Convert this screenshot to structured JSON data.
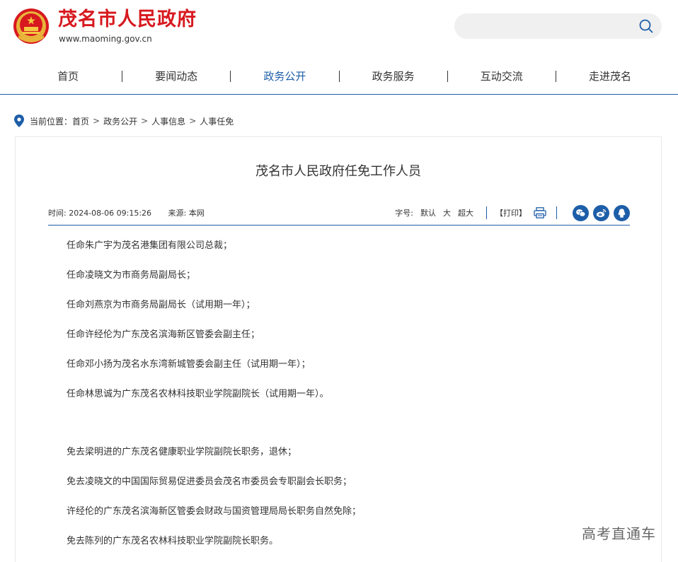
{
  "header": {
    "site_title": "茂名市人民政府",
    "site_url": "www.maoming.gov.cn",
    "search_placeholder": ""
  },
  "nav": {
    "items": [
      {
        "label": "首页"
      },
      {
        "label": "要闻动态"
      },
      {
        "label": "政务公开"
      },
      {
        "label": "政务服务"
      },
      {
        "label": "互动交流"
      },
      {
        "label": "走进茂名"
      }
    ],
    "active_index": 2
  },
  "breadcrumb": {
    "prefix": "当前位置：",
    "items": [
      "首页",
      "政务公开",
      "人事信息",
      "人事任免"
    ],
    "separator": ">"
  },
  "article": {
    "title": "茂名市人民政府任免工作人员",
    "time": "时间: 2024-08-06 09:15:26",
    "source": "来源: 本网",
    "font_size_label": "字号:",
    "font_size_options": [
      "默认",
      "大",
      "超大"
    ],
    "print_label": "【打印】",
    "paragraphs_appoint": [
      "任命朱广宇为茂名港集团有限公司总裁；",
      "任命凌晓文为市商务局副局长；",
      "任命刘燕京为市商务局副局长（试用期一年）；",
      "任命许经伦为广东茂名滨海新区管委会副主任；",
      "任命邓小扬为茂名水东湾新城管委会副主任（试用期一年）；",
      "任命林思诚为广东茂名农林科技职业学院副院长（试用期一年）。"
    ],
    "paragraphs_remove": [
      "免去梁明进的广东茂名健康职业学院副院长职务，退休；",
      "免去凌晓文的中国国际贸易促进委员会茂名市委员会专职副会长职务；",
      "许经伦的广东茂名滨海新区管委会财政与国资管理局局长职务自然免除；",
      "免去陈列的广东茂名农林科技职业学院副院长职务。"
    ]
  },
  "watermark": "高考直通车",
  "colors": {
    "brand_red": "#d7191f",
    "brand_blue": "#1d5ea8",
    "search_bg": "#f0f0f0"
  },
  "icons": [
    "national-emblem-icon",
    "search-icon",
    "location-pin-icon",
    "printer-icon",
    "wechat-icon",
    "weibo-icon",
    "qq-icon"
  ]
}
